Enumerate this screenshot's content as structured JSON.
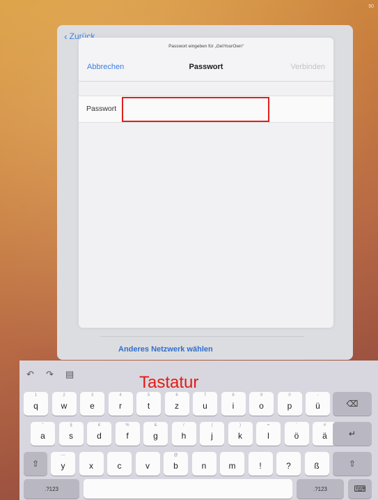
{
  "status_text": "90",
  "back_sheet": {
    "back_label": "Zurück",
    "other_network": "Anderes Netzwerk wählen"
  },
  "modal": {
    "subtitle": "Passwort eingeben für „GetYourOwn“",
    "cancel": "Abbrechen",
    "title": "Passwort",
    "connect": "Verbinden",
    "password_label": "Passwort",
    "password_value": ""
  },
  "keyboard": {
    "annotation": "Tastatur",
    "toolbar": {
      "undo": "↶",
      "redo": "↷",
      "paste": "▤"
    },
    "row1": [
      {
        "main": "q",
        "hint": "1"
      },
      {
        "main": "w",
        "hint": "2"
      },
      {
        "main": "e",
        "hint": "3"
      },
      {
        "main": "r",
        "hint": "4"
      },
      {
        "main": "t",
        "hint": "5"
      },
      {
        "main": "z",
        "hint": "6"
      },
      {
        "main": "u",
        "hint": "7"
      },
      {
        "main": "i",
        "hint": "8"
      },
      {
        "main": "o",
        "hint": "9"
      },
      {
        "main": "p",
        "hint": "0"
      },
      {
        "main": "ü",
        "hint": "-"
      }
    ],
    "row2": [
      {
        "main": "a",
        "hint": "\""
      },
      {
        "main": "s",
        "hint": "§"
      },
      {
        "main": "d",
        "hint": "€"
      },
      {
        "main": "f",
        "hint": "%"
      },
      {
        "main": "g",
        "hint": "&"
      },
      {
        "main": "h",
        "hint": "/"
      },
      {
        "main": "j",
        "hint": "("
      },
      {
        "main": "k",
        "hint": ")"
      },
      {
        "main": "l",
        "hint": "="
      },
      {
        "main": "ö",
        "hint": "'"
      },
      {
        "main": "ä",
        "hint": "#"
      }
    ],
    "row3": [
      {
        "main": "y",
        "hint": "—"
      },
      {
        "main": "x",
        "hint": ""
      },
      {
        "main": "c",
        "hint": ""
      },
      {
        "main": "v",
        "hint": ""
      },
      {
        "main": "b",
        "hint": "@"
      },
      {
        "main": "n",
        "hint": ""
      },
      {
        "main": "m",
        "hint": ""
      },
      {
        "main": "!",
        "hint": ""
      },
      {
        "main": "?",
        "hint": ""
      },
      {
        "main": "ß",
        "hint": ""
      }
    ],
    "row3_punct_sub": {
      "excl": ",",
      "quest": "."
    },
    "backspace": "⌫",
    "return": "↵",
    "shift": "⇧",
    "numbers_left": ".?123",
    "numbers_right": ".?123",
    "hide": "⌨"
  }
}
